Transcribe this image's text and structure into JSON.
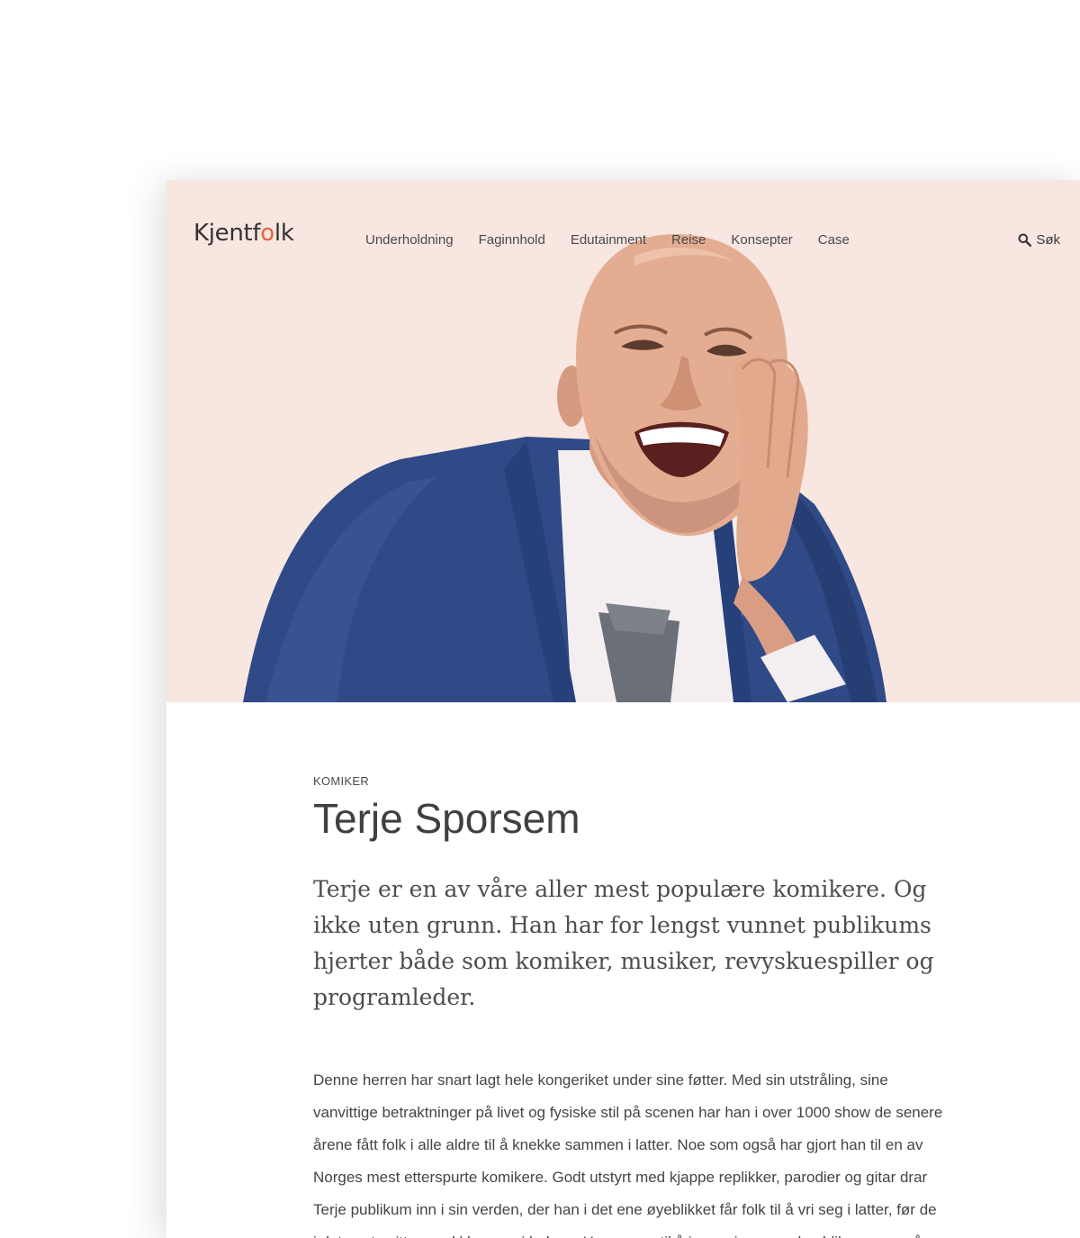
{
  "header": {
    "logo": {
      "prefix": "Kjentf",
      "accent": "o",
      "suffix": "lk"
    },
    "nav": [
      {
        "label": "Underholdning"
      },
      {
        "label": "Faginnhold"
      },
      {
        "label": "Edutainment"
      },
      {
        "label": "Reise"
      },
      {
        "label": "Konsepter"
      },
      {
        "label": "Case"
      }
    ],
    "search_label": "Søk",
    "search_icon": "search-icon"
  },
  "hero": {
    "background_color": "#f8e6e1",
    "image": "portrait-laughing-man"
  },
  "profile": {
    "category": "KOMIKER",
    "name": "Terje Sporsem",
    "lead": "Terje er en av våre aller mest populære komikere. Og ikke uten grunn. Han har for lengst vunnet publikums hjerter både som komiker, musiker, revyskuespiller og programleder.",
    "body": "Denne herren har snart lagt hele kongeriket under sine føtter. Med sin utstråling, sine vanvittige betraktninger på livet og fysiske stil på scenen har han i over 1000 show de senere årene fått folk i alle aldre til å knekke sammen i latter. Noe som også har gjort han til en av Norges mest etterspurte komikere. Godt utstyrt med kjappe replikker, parodier og gitar drar Terje publikum inn i sin verden, der han i det ene øyeblikket får folk til å vri seg i latter, før de i det neste sitter med klumpen i halsen. Hans evne til å improvisere med publikum er også en"
  },
  "colors": {
    "accent": "#e8643a",
    "hero_bg": "#f8e6e1",
    "jacket": "#2f4a86"
  }
}
